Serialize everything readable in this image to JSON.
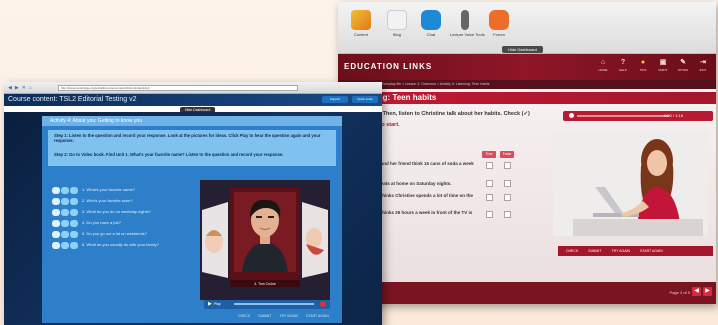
{
  "colors": {
    "red_accent": "#c21a33",
    "blue_panel": "#2e7fc9",
    "blue_header": "#0c2d5a"
  },
  "right_window": {
    "toolbar": {
      "tools": [
        {
          "label": "Content",
          "icon": "content-icon"
        },
        {
          "label": "Blog",
          "icon": "blog-icon"
        },
        {
          "label": "Chat",
          "icon": "chat-icon"
        },
        {
          "label": "Lecture Voice Tools",
          "icon": "microphone-icon"
        },
        {
          "label": "Forum",
          "icon": "forum-icon"
        }
      ],
      "hide_label": "Hide Dashboard"
    },
    "brand": "EDUCATION LINKS",
    "nav": [
      {
        "icon": "home-icon",
        "label": "HOME"
      },
      {
        "icon": "help-icon",
        "label": "HELP"
      },
      {
        "icon": "tips-icon",
        "label": "TIPS"
      },
      {
        "icon": "print-icon",
        "label": "PRINT"
      },
      {
        "icon": "notes-icon",
        "label": "NOTES"
      },
      {
        "icon": "exit-icon",
        "label": "EXIT"
      }
    ],
    "breadcrumb": "TSL2 Editorial  >  Unit 1: Everyday life  >  Lesson 4: Grammar  >  Activity 3: Listening: Teen habits",
    "activity_title": "Listening: Teen habits",
    "instruction": "Sentences. Then, listen to Christine talk about her habits. Check (✓)",
    "play_hint": "Click Play to start.",
    "player_time": "0:00 / 1:19",
    "true_label": "True",
    "false_label": "False",
    "statements": [
      "Christine and her friend think 15 cans of soda a week is a lot.",
      "Christine eats at home on Saturday nights.",
      "Her mom thinks Christine spends a lot of time on the phone.",
      "Christine thinks 25 hours a week in front of the TV is fine."
    ],
    "footer_buttons": [
      "CHECK",
      "SUBMIT",
      "TRY AGAIN",
      "START AGAIN"
    ],
    "page": "Page 3 of 9"
  },
  "left_window": {
    "browser_url": "http://www.cambridge.org/us/tsl2/course/content/ch1/unit1/activity4",
    "course_title": "Course content:  TSL2 Editorial Testing v2",
    "header_buttons": [
      "Support",
      "Quick Links"
    ],
    "hide_label": "Hide Dashboard",
    "activity_title": "Activity 4: About you: Getting to know you",
    "step1": "Step 1: Listen to the question and record your response. Look at the pictures for ideas. Click Play to hear the question again and your response.",
    "step2": "Step 2: Go to Video book. Find Unit 1. What's your favorite name? Listen to the question and record your response.",
    "questions": [
      "1. What's your favorite name?",
      "2. Who's your favorite actor?",
      "3. What do you do on weekday nights?",
      "4. Do you have a job?",
      "5. Do you go out a lot on weekends?",
      "6. What do you usually do with your family?"
    ],
    "caption": "4. Tom Cruise",
    "controls": {
      "play": "Play"
    },
    "footer_buttons": [
      "CHECK",
      "SUBMIT",
      "TRY AGAIN",
      "START AGAIN"
    ]
  }
}
